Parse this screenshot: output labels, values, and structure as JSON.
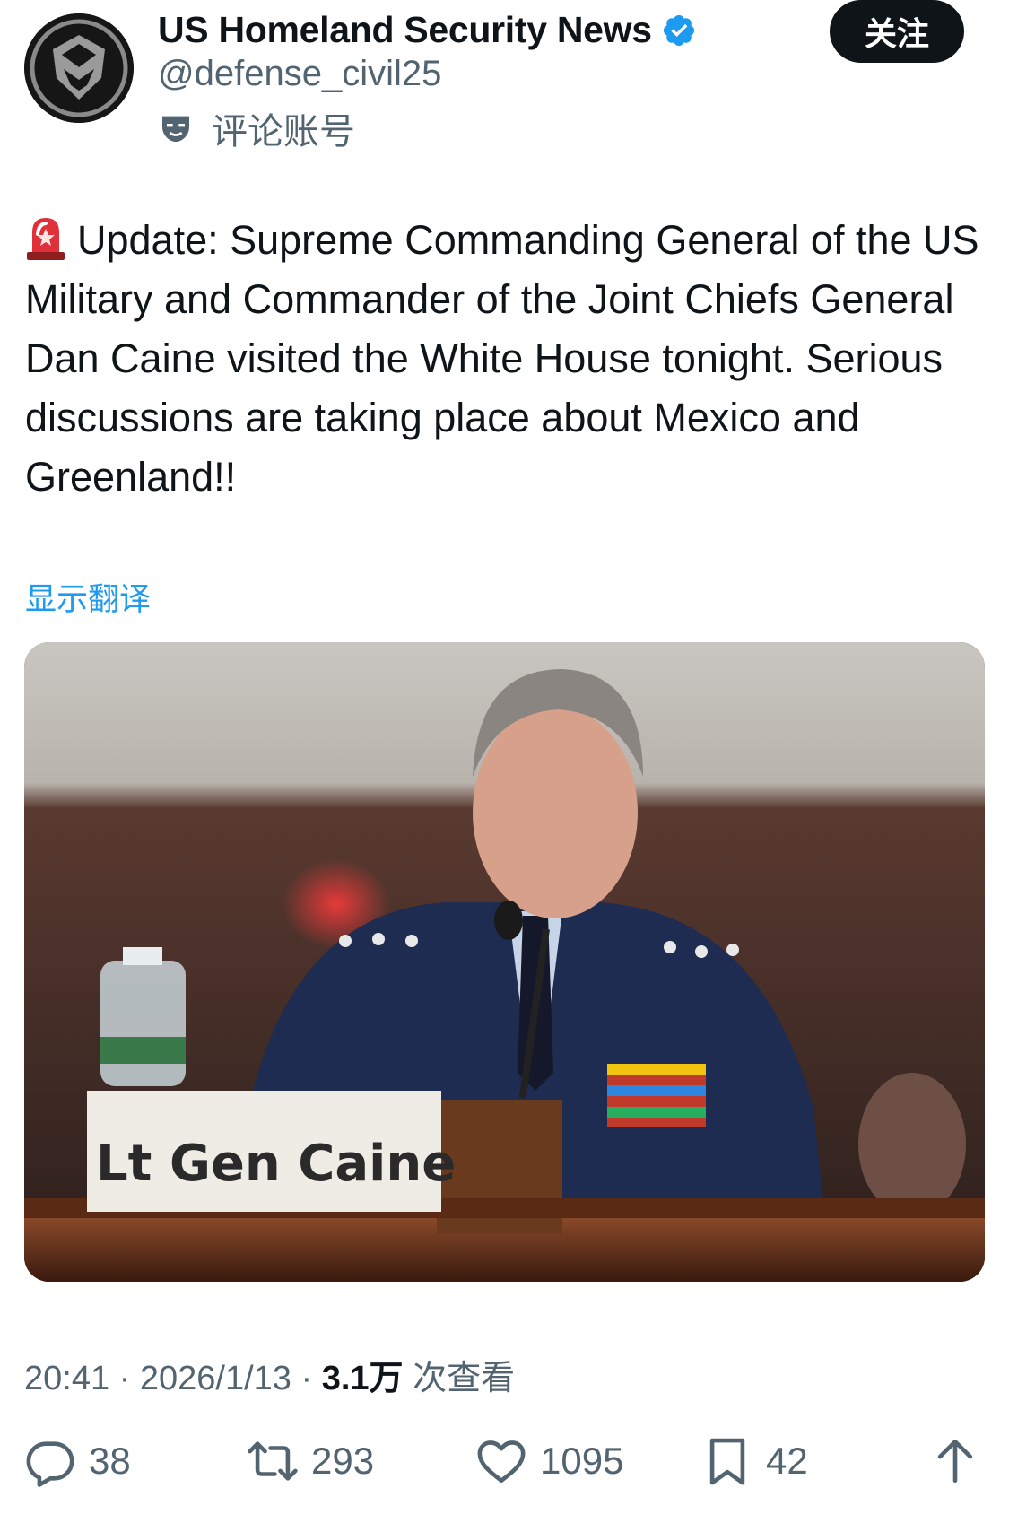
{
  "author": {
    "display_name": "US Homeland Security News",
    "handle": "@defense_civil25",
    "account_label": "评论账号",
    "verified_color": "#1d9bf0"
  },
  "follow_button": {
    "label": "关注"
  },
  "tweet": {
    "emoji": "rotating-light-icon",
    "text": "Update: Supreme Commanding General of the US Military and Commander of the Joint Chiefs General Dan Caine visited the White House tonight. Serious discussions are taking place about Mexico and Greenland!!",
    "translate_label": "显示翻译"
  },
  "media": {
    "nameplate_text": "Lt Gen Caine"
  },
  "meta": {
    "time": "20:41",
    "date": "2026/1/13",
    "separator": "·",
    "views_count": "3.1万",
    "views_label": "次查看"
  },
  "actions": {
    "replies": "38",
    "retweets": "293",
    "likes": "1095",
    "bookmarks": "42"
  },
  "colors": {
    "accent": "#1d9bf0",
    "text_primary": "#0f1419",
    "text_secondary": "#536471"
  }
}
